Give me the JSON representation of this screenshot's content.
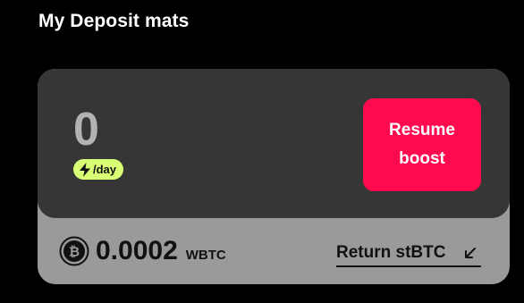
{
  "section": {
    "title": "My Deposit mats"
  },
  "deposit_card": {
    "rate_value": "0",
    "rate_unit": "/day",
    "rate_icon": "bolt-icon",
    "resume_button_label": "Resume boost",
    "balance": {
      "icon": "bitcoin-icon",
      "amount": "0.0002",
      "unit": "WBTC"
    },
    "return_link_label": "Return stBTC",
    "return_link_icon": "arrow-down-left-icon"
  },
  "colors": {
    "page_bg": "#000000",
    "card_top_bg": "#363636",
    "card_bottom_bg": "#9a9a9a",
    "accent_button": "#ff0a4f",
    "badge_bg": "#d9ff75"
  }
}
